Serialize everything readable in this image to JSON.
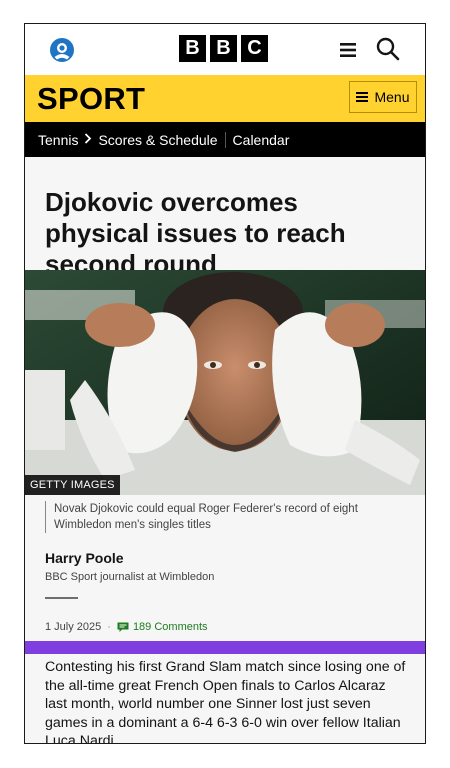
{
  "header": {
    "logo": [
      "B",
      "B",
      "C"
    ],
    "account_icon": "account-icon",
    "menu_icon": "hamburger-icon",
    "search_icon": "search-icon"
  },
  "sport_bar": {
    "title": "SPORT",
    "menu_label": "Menu",
    "color": "#ffd230"
  },
  "section_nav": {
    "items": [
      "Tennis",
      "Scores & Schedule",
      "Calendar"
    ]
  },
  "article": {
    "headline": "Djokovic overcomes physical issues to reach second round",
    "image_credit": "GETTY IMAGES",
    "caption": "Novak Djokovic could equal Roger Federer's record of eight Wimbledon men's singles titles",
    "author_name": "Harry Poole",
    "author_role": "BBC Sport journalist at Wimbledon",
    "date": "1 July 2025",
    "comments": "189 Comments",
    "body": "Contesting his first Grand Slam match since losing one of the all-time great French Open finals to Carlos Alcaraz last month, world number one Sinner lost just seven games in a dominant a 6-4 6-3 6-0 win over fellow Italian Luca Nardi."
  },
  "colors": {
    "accent_purple": "#7f3fe0",
    "comments_green": "#1c7d1f",
    "account_blue": "#1f75c4"
  }
}
